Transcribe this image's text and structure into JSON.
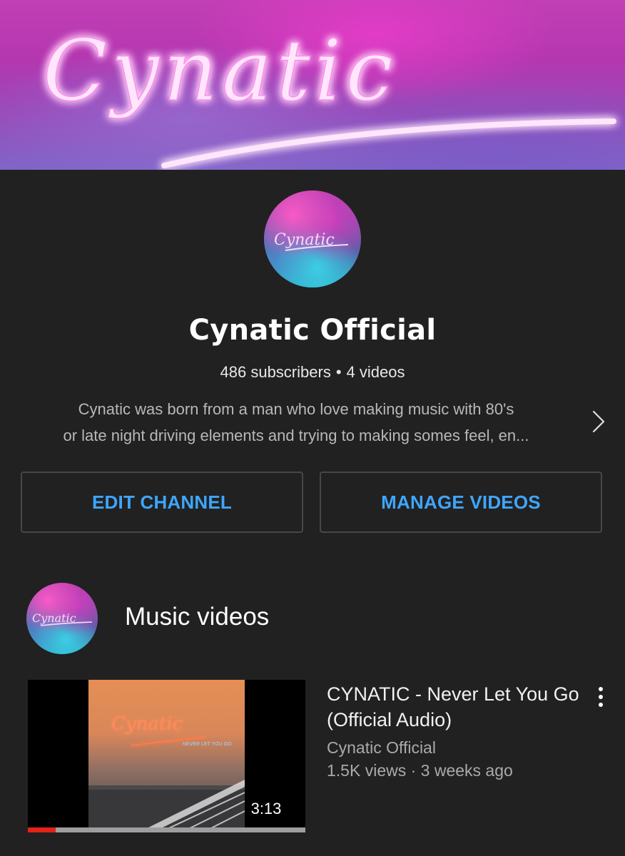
{
  "banner": {
    "art_text": "Cynatic"
  },
  "channel": {
    "name": "Cynatic Official",
    "subscribers": "486 subscribers",
    "separator": "•",
    "video_count": "4 videos",
    "description_line1": "Cynatic was born from a man who love making music with 80's",
    "description_line2": "or late night driving elements and trying to making somes feel, en...",
    "avatar_art_text": "Cynatic"
  },
  "actions": {
    "edit_label": "EDIT CHANNEL",
    "manage_label": "MANAGE VIDEOS"
  },
  "section": {
    "title": "Music videos"
  },
  "video": {
    "title": "CYNATIC - Never Let You Go (Official Audio)",
    "channel": "Cynatic Official",
    "meta": "1.5K views · 3 weeks ago",
    "duration": "3:13",
    "watched_fraction": 0.1,
    "thumb_art_text": "Cynatic",
    "thumb_subtitle": "NEVER LET YOU GO"
  },
  "colors": {
    "background": "#212121",
    "accent_blue": "#3ea6ff",
    "progress_red": "#e62117",
    "neon_pink": "#ff6ee6"
  },
  "icons": {
    "chevron": "chevron-right-icon",
    "more": "more-vertical-icon"
  }
}
